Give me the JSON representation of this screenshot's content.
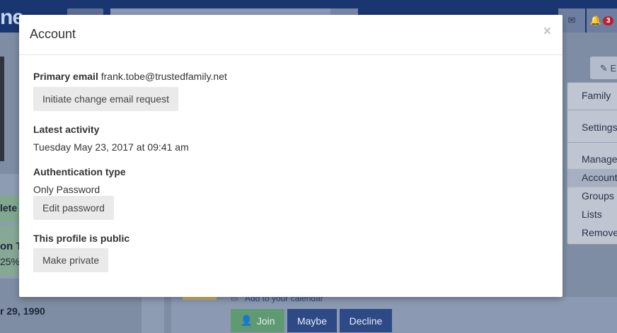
{
  "background": {
    "logo_text": "ne",
    "notification_count": "3",
    "dropdown_items": [
      "Family",
      "Settings",
      "Manage",
      "Account",
      "Groups",
      "Lists",
      "Remove"
    ],
    "left_panel_texts": [
      "lete",
      "on T",
      "25%",
      "r 29, 1990"
    ],
    "calendar_link": "Add to your calendar",
    "join_label": "Join",
    "maybe_label": "Maybe",
    "decline_label": "Decline",
    "edit_label": "E"
  },
  "modal": {
    "title": "Account",
    "close_symbol": "×",
    "primary_email_label": "Primary email",
    "primary_email_value": "frank.tobe@trustedfamily.net",
    "change_email_button": "Initiate change email request",
    "latest_activity_label": "Latest activity",
    "latest_activity_value": "Tuesday May 23, 2017 at 09:41 am",
    "auth_type_label": "Authentication type",
    "auth_type_value": "Only Password",
    "edit_password_button": "Edit password",
    "profile_public_label": "This profile is public",
    "make_private_button": "Make private"
  }
}
